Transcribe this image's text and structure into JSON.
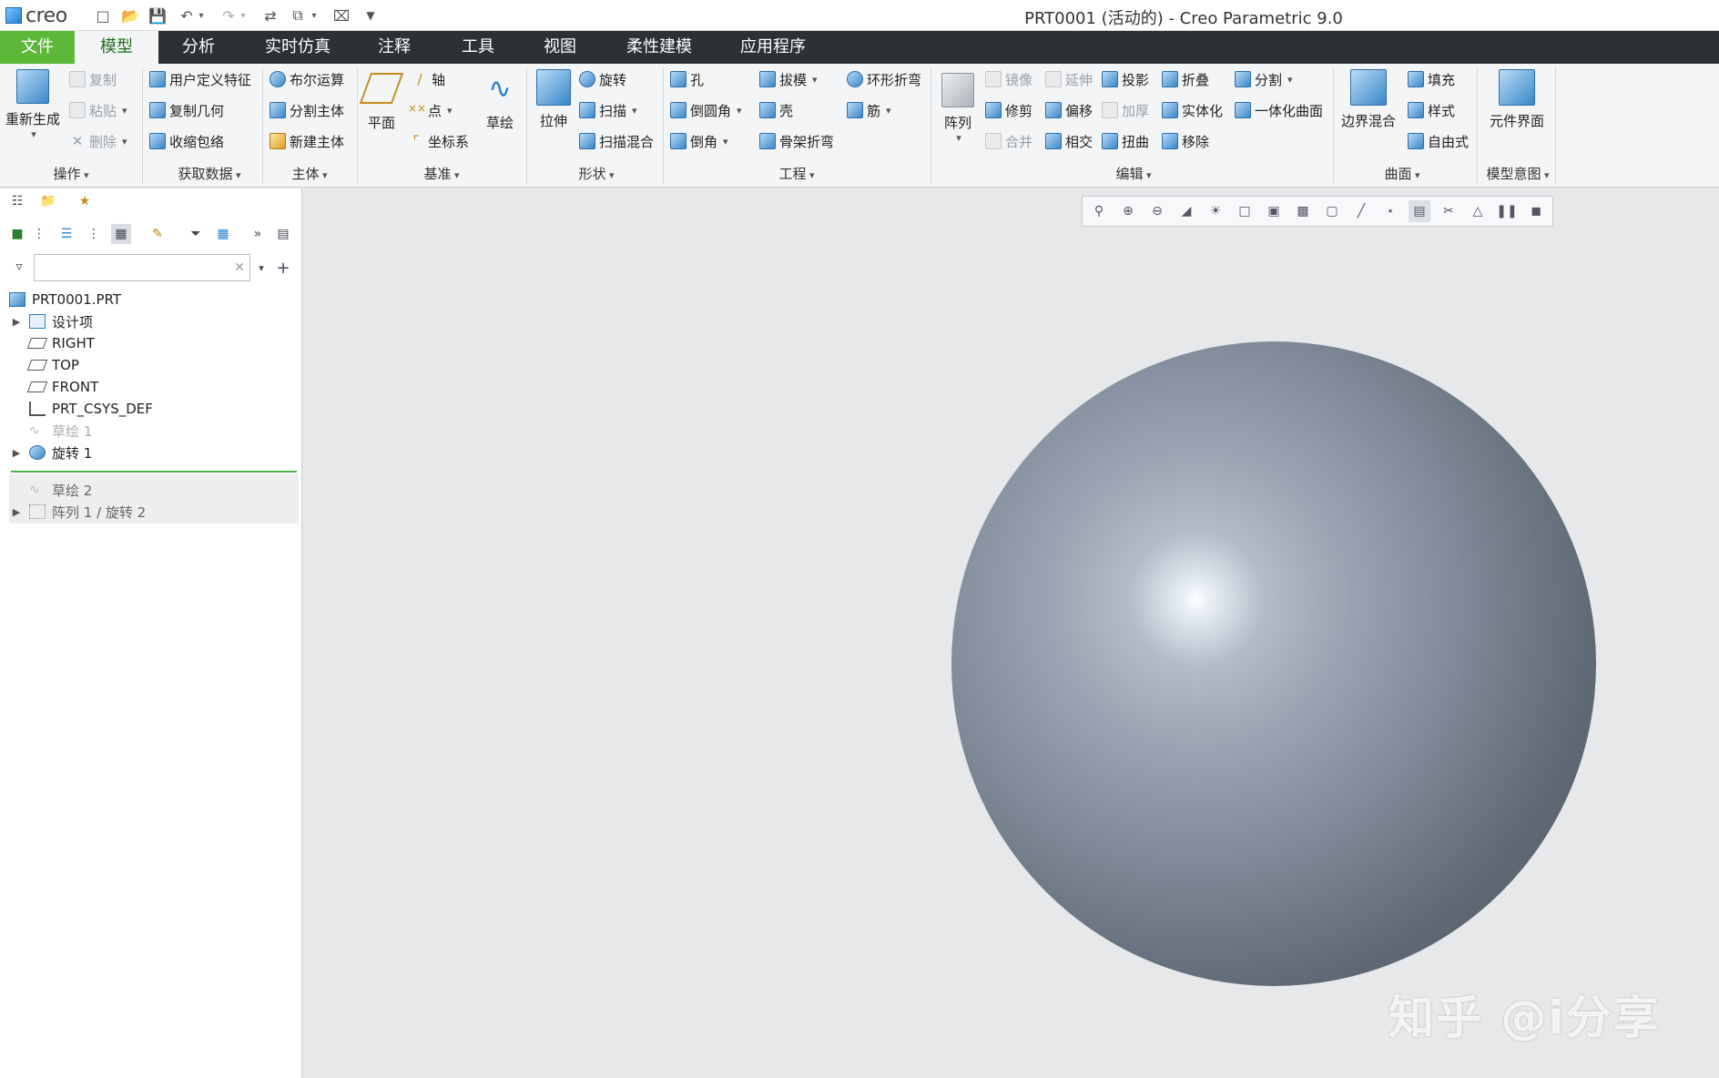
{
  "app": {
    "logo_text": "creo",
    "window_title": "PRT0001 (活动的) - Creo Parametric 9.0"
  },
  "quick_access": [
    "new-icon",
    "open-icon",
    "save-icon",
    "undo-icon",
    "redo-icon",
    "regenerate-icon",
    "windows-icon",
    "close-icon",
    "customize-icon"
  ],
  "tabs": [
    "文件",
    "模型",
    "分析",
    "实时仿真",
    "注释",
    "工具",
    "视图",
    "柔性建模",
    "应用程序"
  ],
  "ribbon": {
    "operations": {
      "label": "操作",
      "regenerate": "重新生成",
      "copy": "复制",
      "paste": "粘贴",
      "delete": "删除"
    },
    "get_data": {
      "label": "获取数据",
      "udf": "用户定义特征",
      "copy_geom": "复制几何",
      "shrinkwrap": "收缩包络"
    },
    "body": {
      "label": "主体",
      "boolean": "布尔运算",
      "split_body": "分割主体",
      "new_body": "新建主体"
    },
    "datum": {
      "label": "基准",
      "plane": "平面",
      "axis": "轴",
      "point": "点",
      "csys": "坐标系",
      "sketch": "草绘"
    },
    "shapes": {
      "label": "形状",
      "extrude": "拉伸",
      "revolve": "旋转",
      "sweep": "扫描",
      "swept_blend": "扫描混合"
    },
    "engineering": {
      "label": "工程",
      "hole": "孔",
      "round": "倒圆角",
      "chamfer": "倒角",
      "draft": "拔模",
      "shell": "壳",
      "spinal_bend": "骨架折弯",
      "toroidal_bend": "环形折弯",
      "rib": "筋"
    },
    "editing": {
      "label": "编辑",
      "pattern": "阵列",
      "mirror": "镜像",
      "trim": "修剪",
      "merge": "合并",
      "extend": "延伸",
      "offset": "偏移",
      "intersect": "相交",
      "project": "投影",
      "thicken": "加厚",
      "twist": "扭曲",
      "fold": "折叠",
      "solidify": "实体化",
      "remove": "移除",
      "split": "分割",
      "unify": "一体化曲面"
    },
    "surfaces": {
      "label": "曲面",
      "boundary_blend": "边界混合",
      "fill": "填充",
      "style": "样式",
      "freestyle": "自由式"
    },
    "model_intent": {
      "label": "模型意图",
      "component_interface": "元件界面"
    }
  },
  "model_tree": {
    "filter_placeholder": "",
    "items": [
      {
        "label": "PRT0001.PRT"
      },
      {
        "label": "设计项"
      },
      {
        "label": "RIGHT"
      },
      {
        "label": "TOP"
      },
      {
        "label": "FRONT"
      },
      {
        "label": "PRT_CSYS_DEF"
      },
      {
        "label": "草绘 1"
      },
      {
        "label": "旋转 1"
      },
      {
        "label": "草绘 2"
      },
      {
        "label": "阵列 1 / 旋转 2"
      }
    ]
  },
  "graphics": {
    "watermark": "知乎 @i分享",
    "sphere_color": "#7f8997"
  }
}
